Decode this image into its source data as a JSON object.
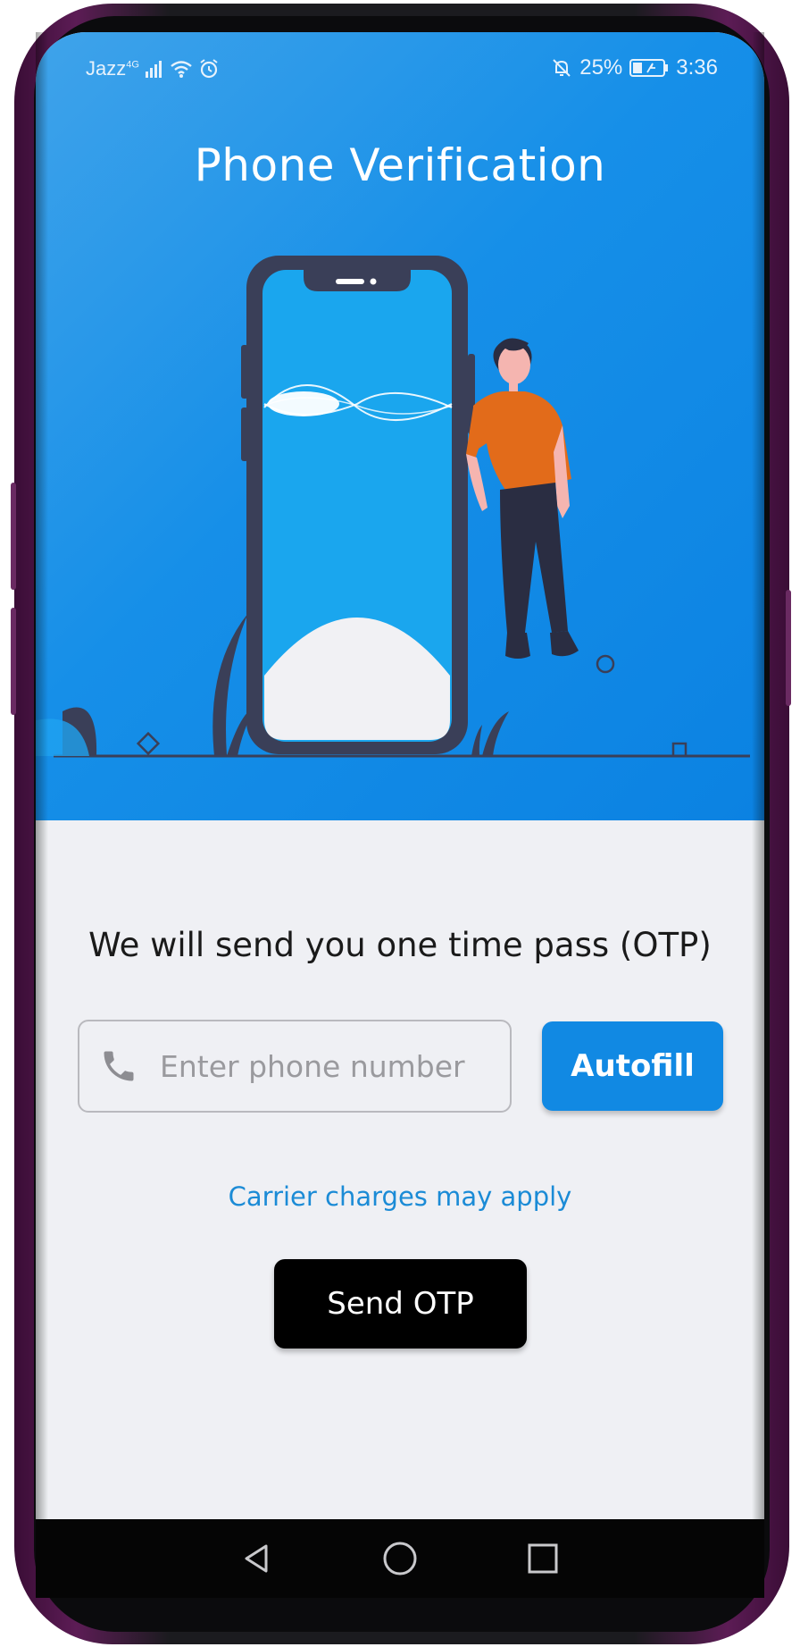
{
  "status_bar": {
    "carrier": "Jazz",
    "network": "4G",
    "battery": "25%",
    "time": "3:36"
  },
  "header": {
    "title": "Phone Verification"
  },
  "main": {
    "otp_message": "We will send you one time pass (OTP)",
    "phone_input": {
      "placeholder": "Enter phone number",
      "value": ""
    },
    "autofill_label": "Autofill",
    "carrier_note": "Carrier charges may apply",
    "send_otp_label": "Send OTP"
  },
  "nav_bar": {
    "icons": [
      "back-icon",
      "home-icon",
      "recents-icon"
    ]
  },
  "colors": {
    "hero_blue": "#168fe8",
    "button_blue": "#1189e3",
    "link_blue": "#1b8bd6",
    "send_button": "#000000",
    "background": "#eff0f4"
  }
}
